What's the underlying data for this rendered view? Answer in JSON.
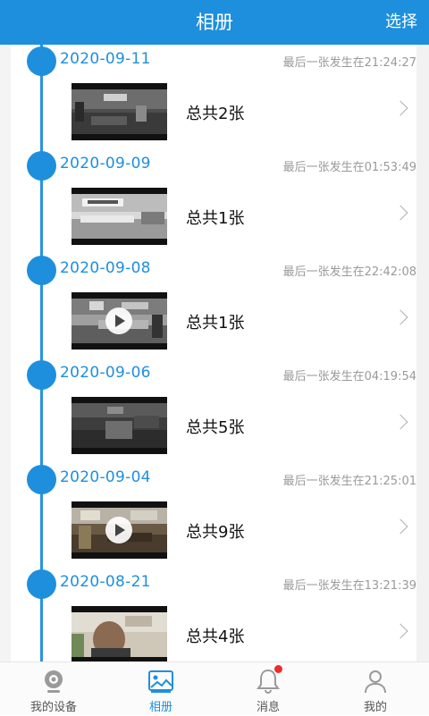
{
  "header": {
    "title": "相册",
    "action": "选择"
  },
  "groups": [
    {
      "date": "2020-09-11",
      "last": "最后一张发生在21:24:27",
      "count": "总共2张",
      "video": false
    },
    {
      "date": "2020-09-09",
      "last": "最后一张发生在01:53:49",
      "count": "总共1张",
      "video": false
    },
    {
      "date": "2020-09-08",
      "last": "最后一张发生在22:42:08",
      "count": "总共1张",
      "video": true
    },
    {
      "date": "2020-09-06",
      "last": "最后一张发生在04:19:54",
      "count": "总共5张",
      "video": false
    },
    {
      "date": "2020-09-04",
      "last": "最后一张发生在21:25:01",
      "count": "总共9张",
      "video": true
    },
    {
      "date": "2020-08-21",
      "last": "最后一张发生在13:21:39",
      "count": "总共4张",
      "video": false
    }
  ],
  "tabs": [
    {
      "label": "我的设备",
      "icon": "camera-icon",
      "active": false
    },
    {
      "label": "相册",
      "icon": "album-icon",
      "active": true
    },
    {
      "label": "消息",
      "icon": "bell-icon",
      "active": false,
      "badge": true
    },
    {
      "label": "我的",
      "icon": "user-icon",
      "active": false
    }
  ],
  "colors": {
    "accent": "#1e8fdd",
    "badge": "#ee2b2b"
  }
}
